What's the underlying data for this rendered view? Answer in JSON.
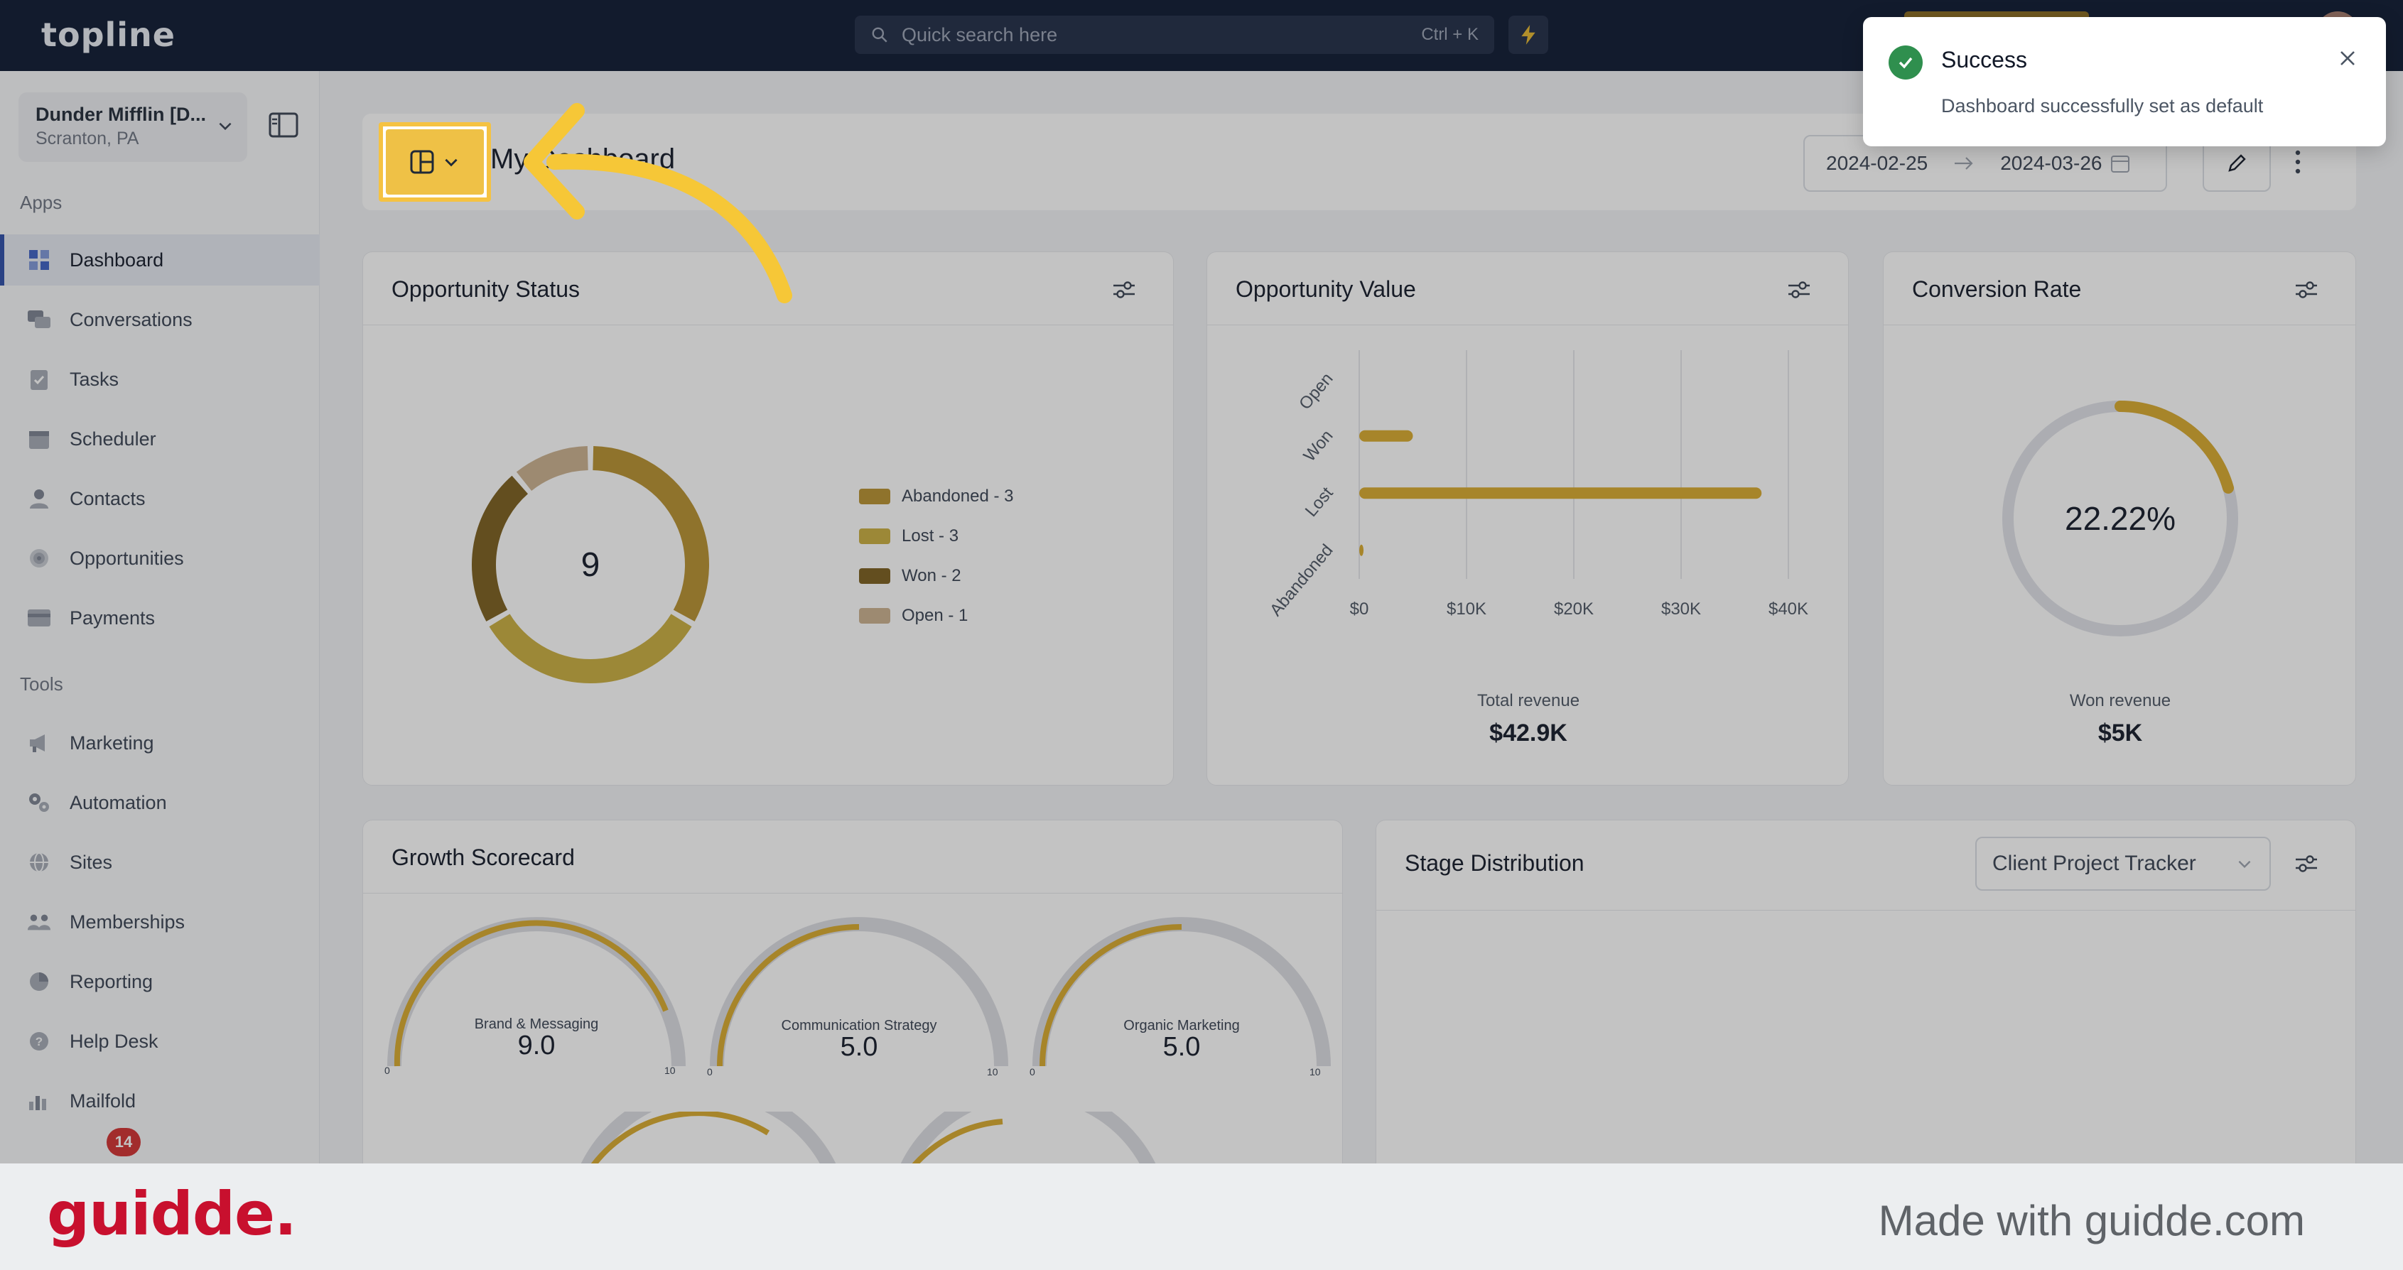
{
  "app": {
    "logo": "topline"
  },
  "topbar": {
    "search_placeholder": "Quick search here",
    "search_shortcut": "Ctrl + K"
  },
  "sidebar": {
    "account_name": "Dunder Mifflin [D...",
    "account_location": "Scranton, PA",
    "apps_label": "Apps",
    "tools_label": "Tools",
    "apps": [
      {
        "label": "Dashboard",
        "icon": "dashboard-icon"
      },
      {
        "label": "Conversations",
        "icon": "chat-icon"
      },
      {
        "label": "Tasks",
        "icon": "tasks-icon"
      },
      {
        "label": "Scheduler",
        "icon": "calendar-icon"
      },
      {
        "label": "Contacts",
        "icon": "person-icon"
      },
      {
        "label": "Opportunities",
        "icon": "target-icon"
      },
      {
        "label": "Payments",
        "icon": "card-icon"
      }
    ],
    "tools": [
      {
        "label": "Marketing",
        "icon": "megaphone-icon"
      },
      {
        "label": "Automation",
        "icon": "gears-icon"
      },
      {
        "label": "Sites",
        "icon": "globe-icon"
      },
      {
        "label": "Memberships",
        "icon": "people-icon"
      },
      {
        "label": "Reporting",
        "icon": "pie-icon"
      },
      {
        "label": "Help Desk",
        "icon": "help-icon"
      },
      {
        "label": "Mailfold",
        "icon": "chart-icon"
      }
    ],
    "notification_count": "14"
  },
  "header": {
    "title": "My Dashboard",
    "date_start": "2024-02-25",
    "date_end": "2024-03-26"
  },
  "toast": {
    "title": "Success",
    "message": "Dashboard successfully set as default"
  },
  "opportunity_status": {
    "title": "Opportunity Status",
    "center_value": "9",
    "legend": [
      {
        "label": "Abandoned - 3",
        "color": "#b8902f"
      },
      {
        "label": "Lost - 3",
        "color": "#c9ad3e"
      },
      {
        "label": "Won - 2",
        "color": "#7a5d1c"
      },
      {
        "label": "Open - 1",
        "color": "#cbb08e"
      }
    ]
  },
  "opportunity_value": {
    "title": "Opportunity Value",
    "total_label": "Total revenue",
    "total_value": "$42.9K"
  },
  "conversion_rate": {
    "title": "Conversion Rate",
    "value": "22.22%",
    "won_label": "Won revenue",
    "won_value": "$5K"
  },
  "growth_scorecard": {
    "title": "Growth Scorecard",
    "gauges": [
      {
        "label": "Brand & Messaging",
        "value": "9.0",
        "min": "0",
        "max": "10"
      },
      {
        "label": "Communication Strategy",
        "value": "5.0",
        "min": "0",
        "max": "10"
      },
      {
        "label": "Organic Marketing",
        "value": "5.0",
        "min": "0",
        "max": "10"
      }
    ]
  },
  "stage_distribution": {
    "title": "Stage Distribution",
    "pipeline": "Client Project Tracker"
  },
  "footer": {
    "brand": "guidde.",
    "made_with": "Made with guidde.com"
  },
  "chart_data": [
    {
      "type": "pie",
      "title": "Opportunity Status",
      "categories": [
        "Abandoned",
        "Lost",
        "Won",
        "Open"
      ],
      "values": [
        3,
        3,
        2,
        1
      ],
      "legend": "right"
    },
    {
      "type": "bar",
      "title": "Opportunity Value",
      "orientation": "horizontal",
      "categories": [
        "Open",
        "Won",
        "Lost",
        "Abandoned"
      ],
      "values": [
        0,
        5000,
        37500,
        400
      ],
      "x_ticks": [
        "$0",
        "$10K",
        "$20K",
        "$30K",
        "$40K"
      ],
      "xlim": [
        0,
        40000
      ],
      "grid": true
    }
  ]
}
